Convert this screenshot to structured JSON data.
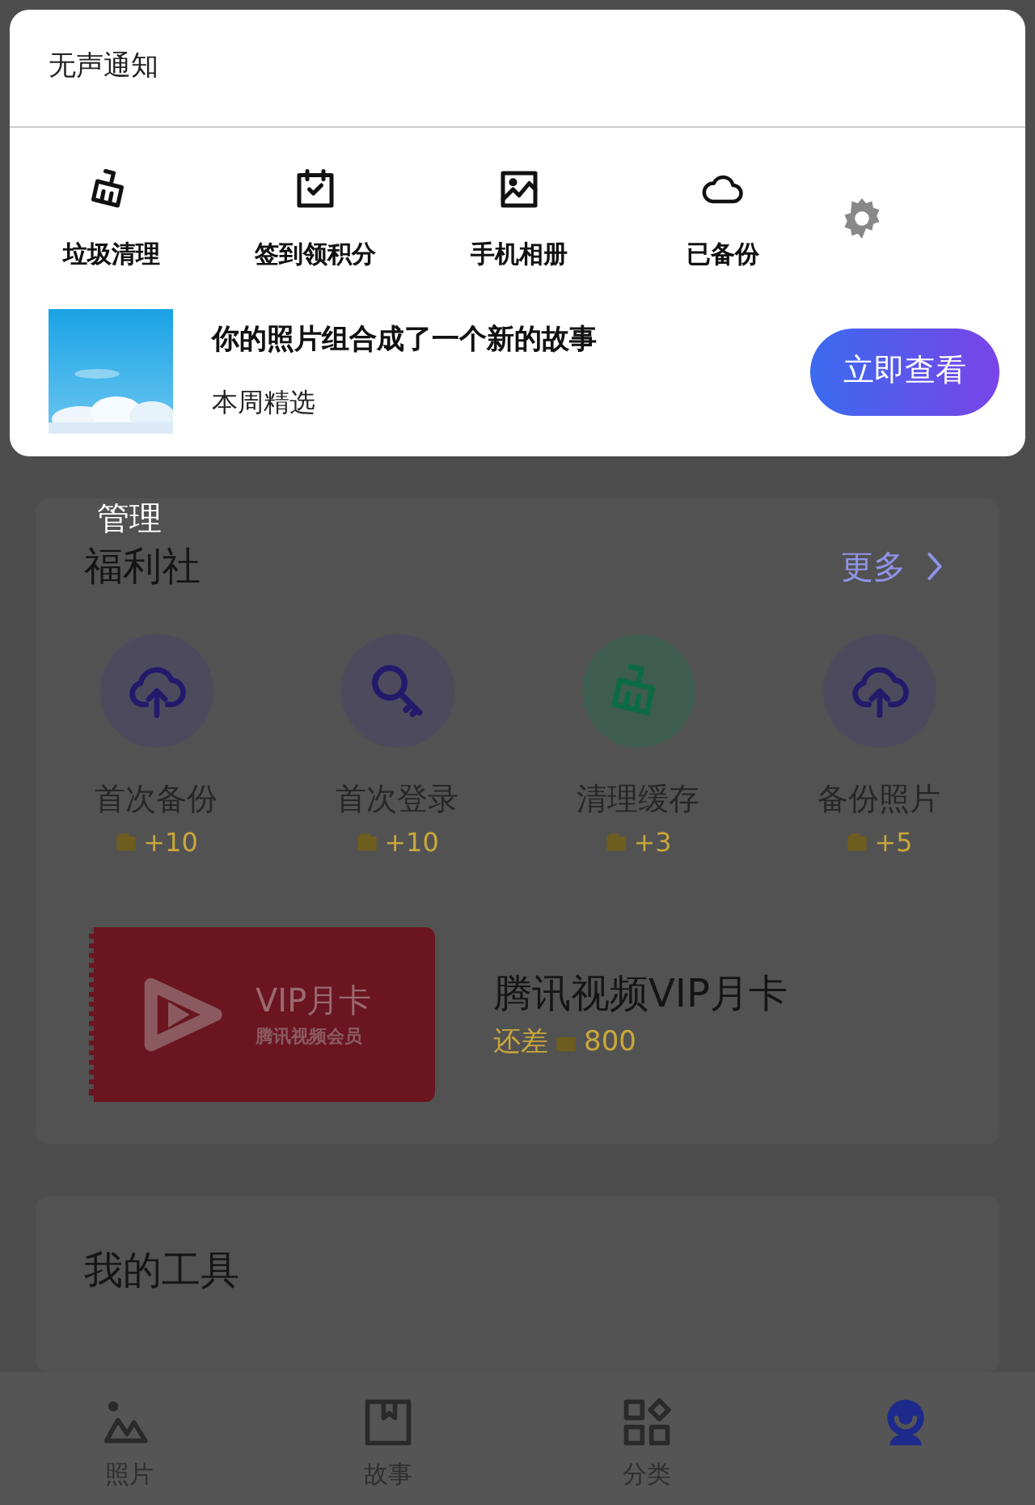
{
  "notification": {
    "header": "无声通知",
    "actions": [
      {
        "label": "垃圾清理",
        "kind": "broom"
      },
      {
        "label": "签到领积分",
        "kind": "calendar"
      },
      {
        "label": "手机相册",
        "kind": "album"
      },
      {
        "label": "已备份",
        "kind": "cloud"
      }
    ],
    "story": {
      "title": "你的照片组合成了一个新的故事",
      "subtitle": "本周精选",
      "button": "立即查看"
    }
  },
  "overlay_label": "管理",
  "welfare": {
    "title": "福利社",
    "more": "更多",
    "tasks": [
      {
        "name": "首次备份",
        "reward": "+10",
        "kind": "upload"
      },
      {
        "name": "首次登录",
        "reward": "+10",
        "kind": "key"
      },
      {
        "name": "清理缓存",
        "reward": "+3",
        "kind": "broom"
      },
      {
        "name": "备份照片",
        "reward": "+5",
        "kind": "upload"
      }
    ],
    "vip": {
      "card_title": "VIP月卡",
      "card_subtitle": "腾讯视频会员",
      "title": "腾讯视频VIP月卡",
      "need_label": "还差",
      "need_amount": "800"
    }
  },
  "tools": {
    "title": "我的工具"
  },
  "nav": [
    {
      "label": "照片",
      "kind": "photos",
      "selected": false
    },
    {
      "label": "故事",
      "kind": "story",
      "selected": false
    },
    {
      "label": "分类",
      "kind": "category",
      "selected": false
    },
    {
      "kind": "profile",
      "selected": true
    }
  ]
}
